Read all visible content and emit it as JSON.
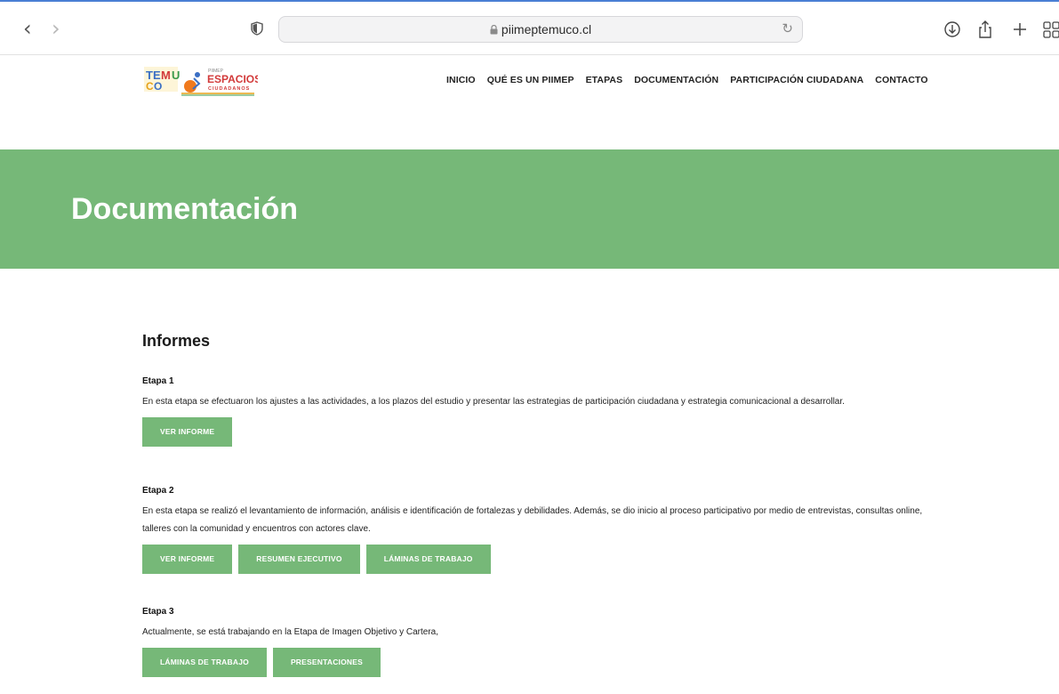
{
  "browser": {
    "url": "piimeptemuco.cl",
    "icons": [
      "back-arrow-icon",
      "forward-arrow-icon",
      "shield-icon",
      "lock-icon",
      "reload-icon",
      "download-icon",
      "share-icon",
      "plus-icon",
      "tabs-grid-icon"
    ]
  },
  "logo": {
    "text_pre": "PIIMEP",
    "text_main": "ESPACIOS",
    "text_sub": "CIUDADANOS"
  },
  "nav": {
    "items": [
      {
        "label": "INICIO"
      },
      {
        "label": "QUÉ ES UN PIIMEP"
      },
      {
        "label": "ETAPAS"
      },
      {
        "label": "DOCUMENTACIÓN"
      },
      {
        "label": "PARTICIPACIÓN CIUDADANA"
      },
      {
        "label": "CONTACTO"
      }
    ]
  },
  "hero": {
    "title": "Documentación",
    "color": "#76b878"
  },
  "content": {
    "section_title": "Informes",
    "stages": [
      {
        "title": "Etapa 1",
        "text": "En esta etapa se efectuaron los ajustes a las actividades, a los plazos del estudio y presentar las estrategias de participación ciudadana y estrategia comunicacional a desarrollar.",
        "buttons": [
          "VER INFORME"
        ]
      },
      {
        "title": "Etapa 2",
        "text": "En esta etapa se realizó el levantamiento de información, análisis e identificación de fortalezas y debilidades. Además, se dio inicio al proceso participativo por medio de entrevistas, consultas online, talleres con la comunidad y encuentros con actores clave.",
        "buttons": [
          "VER INFORME",
          "RESUMEN EJECUTIVO",
          "LÁMINAS DE TRABAJO"
        ]
      },
      {
        "title": "Etapa 3",
        "text": "Actualmente, se está trabajando en la Etapa de Imagen Objetivo y Cartera,",
        "buttons": [
          "LÁMINAS DE TRABAJO",
          "PRESENTACIONES"
        ]
      }
    ]
  }
}
